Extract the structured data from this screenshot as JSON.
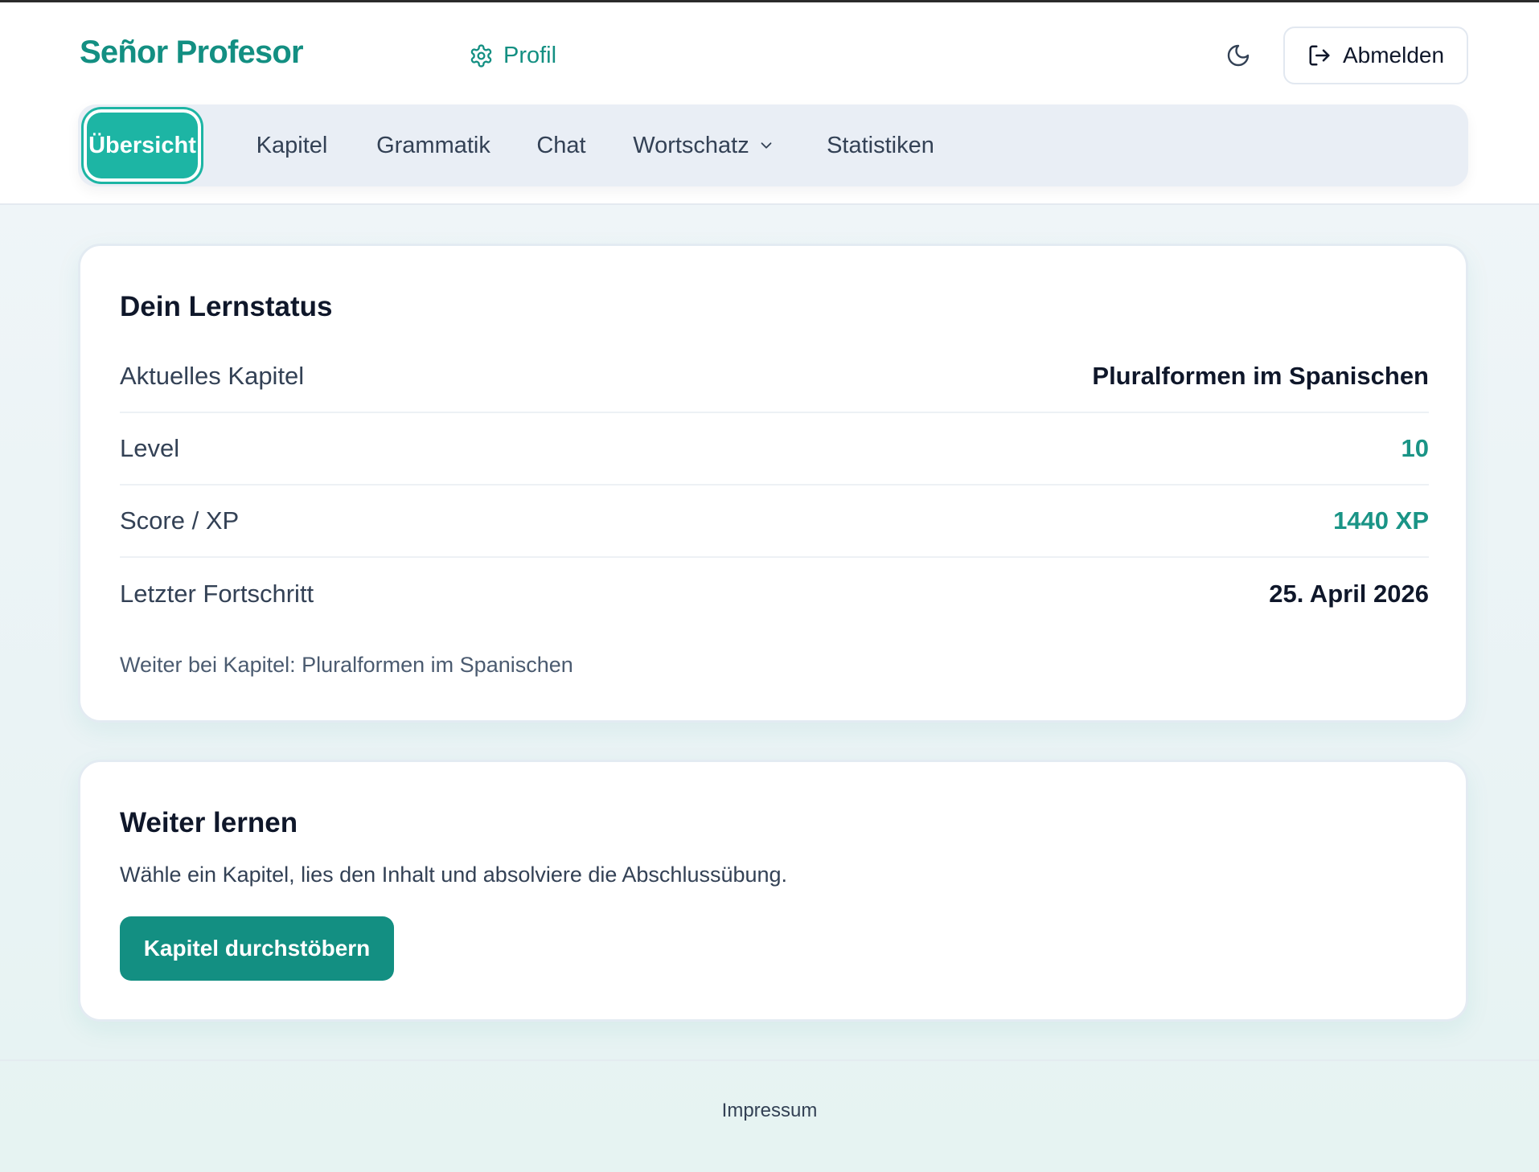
{
  "header": {
    "brand": "Señor Profesor",
    "profile_label": "Profil",
    "logout_label": "Abmelden"
  },
  "nav": {
    "items": [
      {
        "label": "Übersicht",
        "active": true
      },
      {
        "label": "Kapitel"
      },
      {
        "label": "Grammatik"
      },
      {
        "label": "Chat"
      },
      {
        "label": "Wortschatz",
        "dropdown": true
      },
      {
        "label": "Statistiken"
      }
    ]
  },
  "status": {
    "title": "Dein Lernstatus",
    "rows": [
      {
        "label": "Aktuelles Kapitel",
        "value": "Pluralformen im Spanischen"
      },
      {
        "label": "Level",
        "value": "10"
      },
      {
        "label": "Score / XP",
        "value": "1440 XP"
      },
      {
        "label": "Letzter Fortschritt",
        "value": "25. April 2026"
      }
    ],
    "continue_hint": "Weiter bei Kapitel: Pluralformen im Spanischen"
  },
  "continue": {
    "title": "Weiter lernen",
    "description": "Wähle ein Kapitel, lies den Inhalt und absolviere die Abschlussübung.",
    "button_label": "Kapitel durchstöbern"
  },
  "footer": {
    "link_label": "Impressum"
  },
  "icons": {
    "profile": "gear-icon",
    "theme": "moon-icon",
    "logout": "logout-icon",
    "dropdown": "chevron-down-icon"
  },
  "colors": {
    "brand": "#138f82",
    "accent": "#1db5a4",
    "nav_bg": "#e9eef5"
  }
}
